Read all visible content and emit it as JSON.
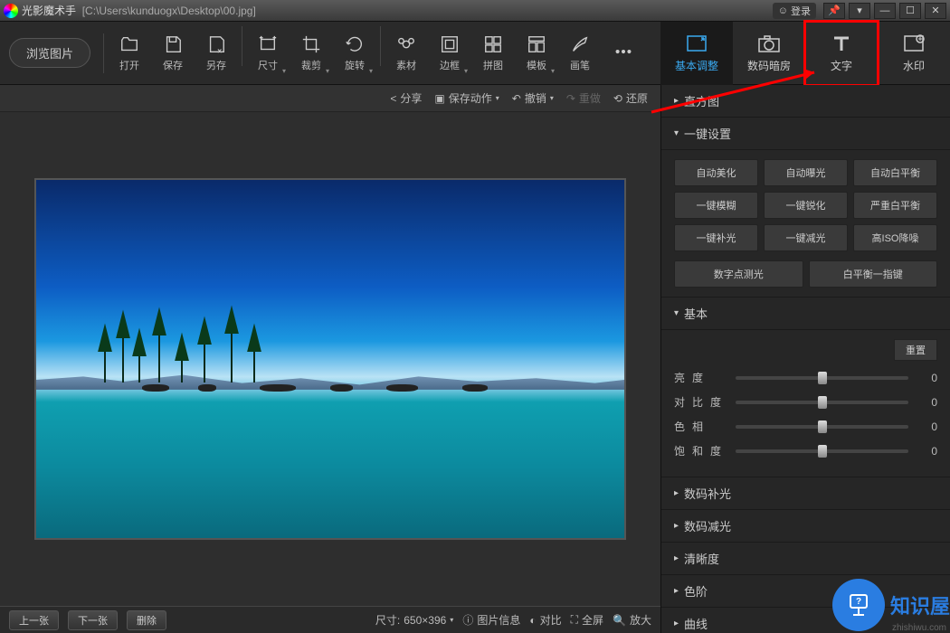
{
  "title": {
    "app_name": "光影魔术手",
    "file_path": "[C:\\Users\\kunduogx\\Desktop\\00.jpg]",
    "login_label": "登录"
  },
  "main_toolbar": {
    "browse": "浏览图片",
    "items": [
      {
        "label": "打开",
        "icon": "open"
      },
      {
        "label": "保存",
        "icon": "save"
      },
      {
        "label": "另存",
        "icon": "saveas"
      },
      {
        "label": "尺寸",
        "icon": "size",
        "dd": true
      },
      {
        "label": "裁剪",
        "icon": "crop",
        "dd": true
      },
      {
        "label": "旋转",
        "icon": "rotate",
        "dd": true
      },
      {
        "label": "素材",
        "icon": "material"
      },
      {
        "label": "边框",
        "icon": "frame",
        "dd": true
      },
      {
        "label": "拼图",
        "icon": "collage"
      },
      {
        "label": "模板",
        "icon": "template",
        "dd": true
      },
      {
        "label": "画笔",
        "icon": "brush"
      },
      {
        "label": "",
        "icon": "more"
      }
    ]
  },
  "right_tabs": [
    {
      "label": "基本调整",
      "icon": "adjust",
      "active": true
    },
    {
      "label": "数码暗房",
      "icon": "camera"
    },
    {
      "label": "文字",
      "icon": "text",
      "highlight": true
    },
    {
      "label": "水印",
      "icon": "watermark"
    }
  ],
  "canvas_toolbar": {
    "share": "分享",
    "save_action": "保存动作",
    "undo": "撤销",
    "redo": "重做",
    "restore": "还原"
  },
  "side": {
    "histogram": "直方图",
    "one_click": "一键设置",
    "grid": [
      "自动美化",
      "自动曝光",
      "自动白平衡",
      "一键模糊",
      "一键锐化",
      "严重白平衡",
      "一键补光",
      "一键减光",
      "高ISO降噪"
    ],
    "row2": [
      "数字点测光",
      "白平衡一指键"
    ],
    "basic_hdr": "基本",
    "reset": "重置",
    "sliders": [
      {
        "label": "亮度",
        "value": 0
      },
      {
        "label": "对比度",
        "value": 0
      },
      {
        "label": "色相",
        "value": 0
      },
      {
        "label": "饱和度",
        "value": 0
      }
    ],
    "collapsed": [
      "数码补光",
      "数码减光",
      "清晰度",
      "色阶",
      "曲线"
    ]
  },
  "bottom": {
    "prev": "上一张",
    "next": "下一张",
    "delete": "删除",
    "size_label": "尺寸:",
    "size_value": "650×396",
    "info": "图片信息",
    "compare": "对比",
    "fullscreen": "全屏",
    "zoom": "放大"
  },
  "logo": {
    "text": "知识屋",
    "url": "zhishiwu.com"
  }
}
